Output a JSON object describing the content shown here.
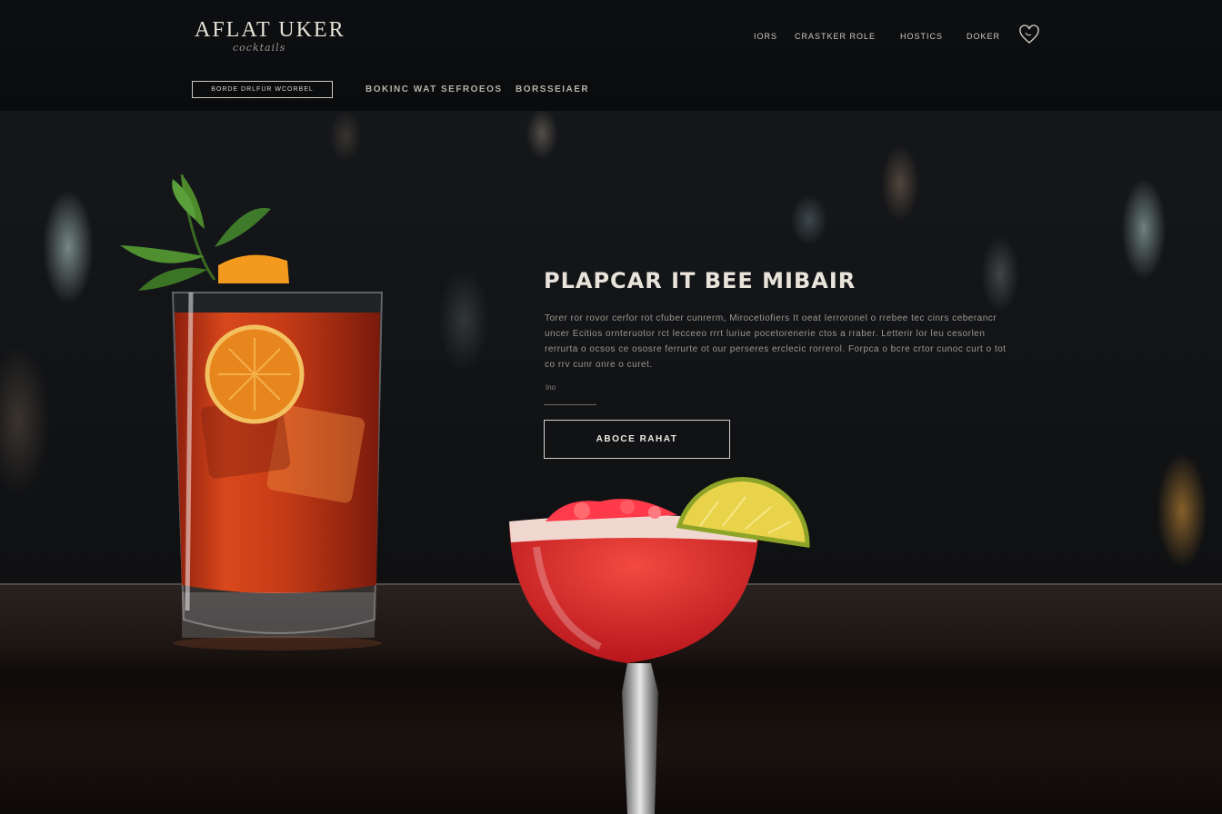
{
  "header": {
    "logo": "AFLAT UKER",
    "logo_sub": "cocktails",
    "nav": [
      "IORS",
      "CRASTKER ROLE",
      "HOSTICS",
      "DOKER"
    ]
  },
  "subnav": {
    "boxed": "BORDE DRLFUR WCORBEL",
    "items": [
      "BOKINC WAT SEFROEOS",
      "BORSSEIAER"
    ]
  },
  "hero": {
    "title": "PLAPCAR IT BEE MIBAIR",
    "text": "Torer ror rovor cerfor rot cfuber cunrerm, Mirocetiofiers It oeat Ierroronel o rrebee tec cinrs ceberancr uncer Ecitios ornteruotor rct lecceeo rrrt luriue pocetorenerie ctos a rraber. Letterir lor leu cesorlen rerrurta o ocsos ce ososre ferrurte ot our perseres erclecic rorrerol. Forpca o bcre crtor cunoc curt o tot co rrv cunr onre o curet.",
    "small": "Ino",
    "cta": "ABOCE RAHAT"
  },
  "colors": {
    "header_bg": "#0c0e11",
    "text_light": "#e8e2d6",
    "text_muted": "#9d9891",
    "counter": "#1c1512",
    "negroni": "#c43a1a",
    "margarita": "#e0262a",
    "lime": "#e9d34a",
    "mint": "#3f7a2a"
  },
  "icons": {
    "favorite": "heart-icon"
  }
}
